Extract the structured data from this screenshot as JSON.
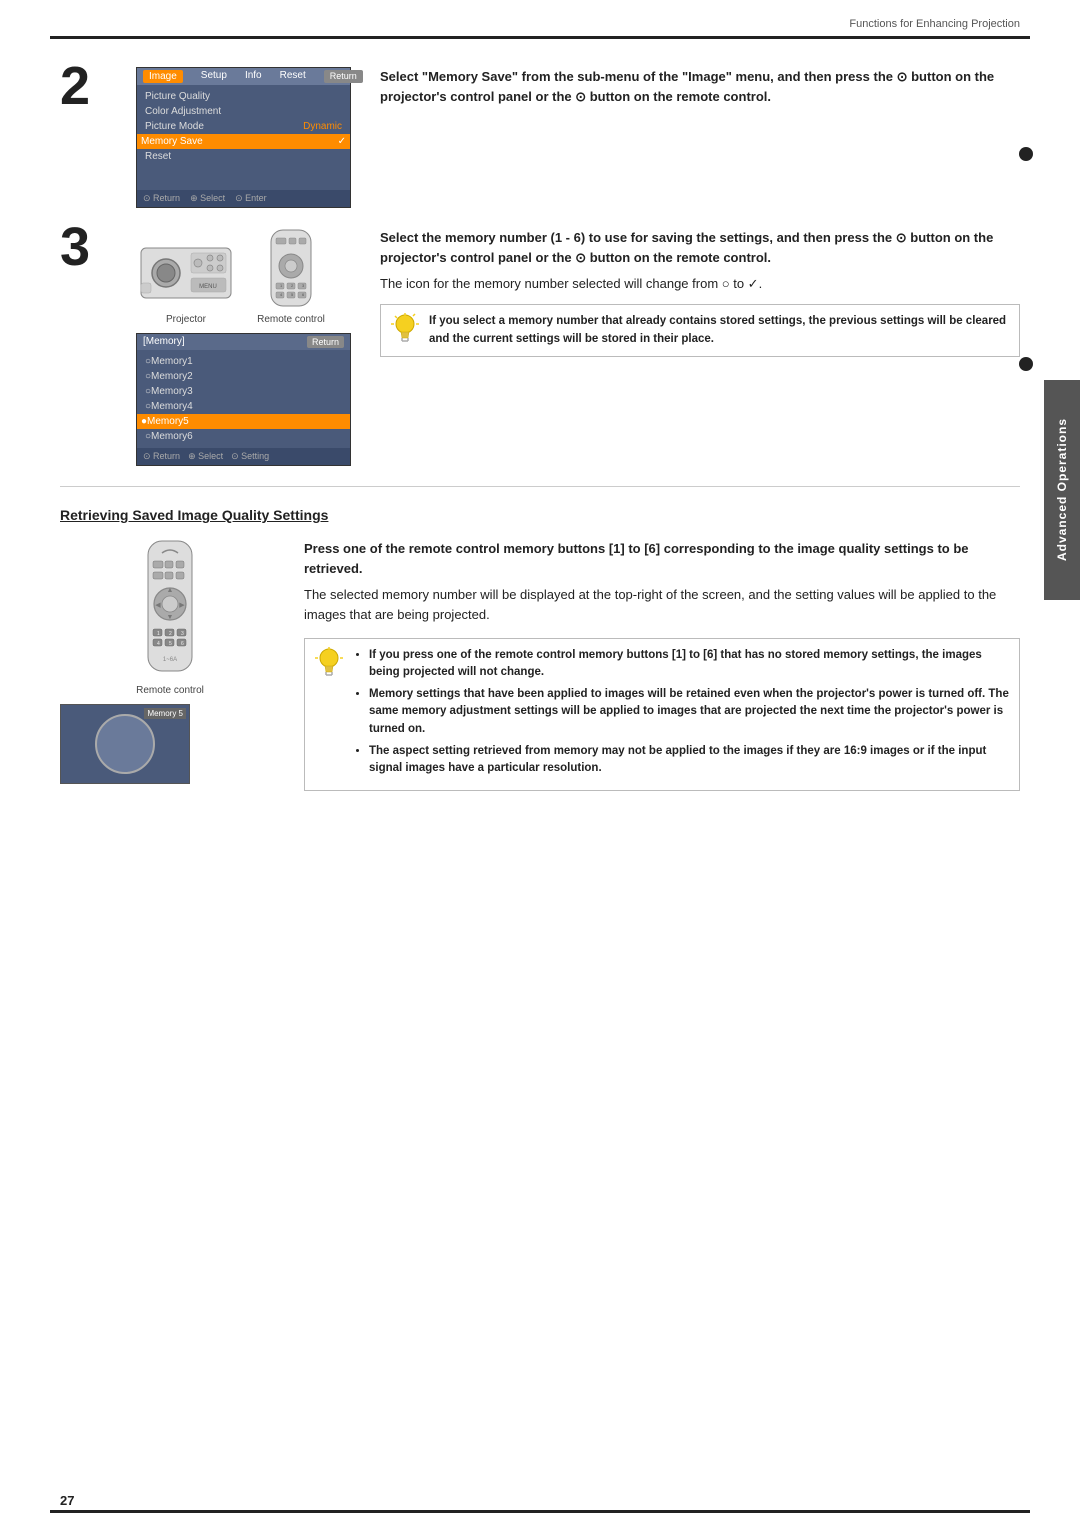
{
  "page": {
    "header": "Functions for Enhancing Projection",
    "page_number": "27"
  },
  "sidebar": {
    "label": "Advanced Operations"
  },
  "step2": {
    "number": "2",
    "instruction": "Select \"Memory Save\" from the sub-menu of the \"Image\" menu, and then press the ⊙ button on the projector's control panel or the ⊙ button on the remote control.",
    "menu": {
      "tabs": [
        "Image",
        "Setup",
        "Info",
        "Reset"
      ],
      "active_tab": "Image",
      "return_btn": "Return",
      "items": [
        "Picture Quality",
        "Color Adjustment",
        "Picture Mode",
        "Memory Save",
        "Reset"
      ],
      "selected_item": "Memory Save",
      "dynamic_value": "Dynamic",
      "bottom_bar": [
        "⊙ Return",
        "⊕ Select",
        "⊙ Enter"
      ]
    }
  },
  "step3": {
    "number": "3",
    "instruction": "Select the memory number (1 - 6) to use for saving the settings, and then press the ⊙ button on the projector's control panel or the ⊙ button on the remote control.",
    "note": "The icon for the memory number selected will change from ○ to ✓.",
    "labels": {
      "projector": "Projector",
      "remote_control": "Remote control"
    },
    "memory_menu": {
      "title": "[Memory]",
      "return_btn": "Return",
      "items": [
        "○Memory1",
        "○Memory2",
        "○Memory3",
        "○Memory4",
        "●Memory5",
        "○Memory6"
      ],
      "selected_item": "●Memory5",
      "bottom_bar": [
        "⊙ Return",
        "⊕ Select",
        "⊙ Setting"
      ]
    },
    "tip": {
      "text": "If you select a memory number that already contains stored settings, the previous settings will be cleared and the current settings will be stored in their place."
    }
  },
  "retrieving": {
    "title": "Retrieving Saved Image Quality Settings",
    "remote_control_label": "Remote control",
    "screen_label": "Memory 5",
    "instruction_heading": "Press one of the remote control memory buttons [1] to [6] corresponding to the image quality settings to be retrieved.",
    "instruction_body": "The selected memory number will be displayed at the top-right of the screen, and the setting values will be applied to the images that are being projected.",
    "tips": [
      "If you press one of the remote control memory buttons [1] to [6] that has no stored memory settings, the images being projected will not change.",
      "Memory settings that have been applied to images will be retained even when the projector's power is turned off. The same memory adjustment settings will be applied to images that are projected the next time the projector's power is turned on.",
      "The aspect setting retrieved from memory may not be applied to the images if they are 16:9 images or if the input signal images have a particular resolution."
    ]
  }
}
